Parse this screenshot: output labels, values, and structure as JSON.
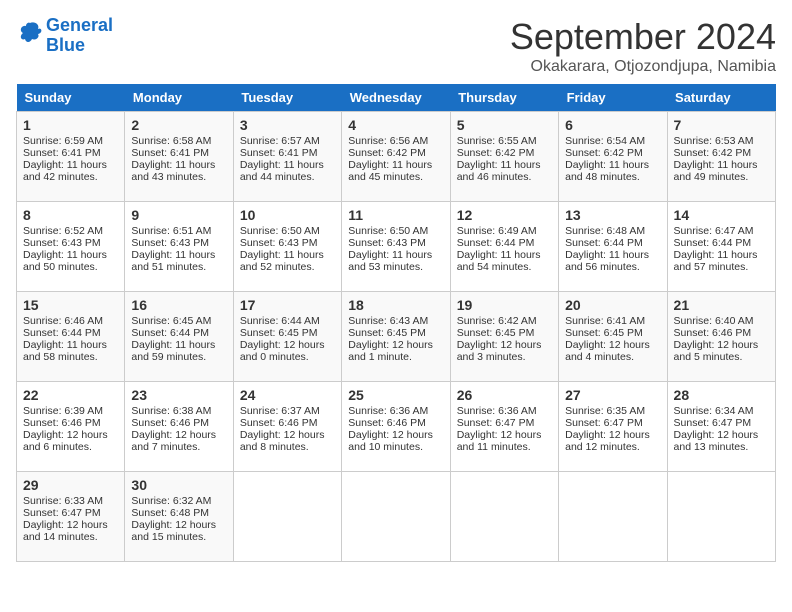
{
  "logo": {
    "line1": "General",
    "line2": "Blue"
  },
  "title": "September 2024",
  "location": "Okakarara, Otjozondjupa, Namibia",
  "days_header": [
    "Sunday",
    "Monday",
    "Tuesday",
    "Wednesday",
    "Thursday",
    "Friday",
    "Saturday"
  ],
  "weeks": [
    [
      {
        "num": "1",
        "lines": [
          "Sunrise: 6:59 AM",
          "Sunset: 6:41 PM",
          "Daylight: 11 hours",
          "and 42 minutes."
        ]
      },
      {
        "num": "2",
        "lines": [
          "Sunrise: 6:58 AM",
          "Sunset: 6:41 PM",
          "Daylight: 11 hours",
          "and 43 minutes."
        ]
      },
      {
        "num": "3",
        "lines": [
          "Sunrise: 6:57 AM",
          "Sunset: 6:41 PM",
          "Daylight: 11 hours",
          "and 44 minutes."
        ]
      },
      {
        "num": "4",
        "lines": [
          "Sunrise: 6:56 AM",
          "Sunset: 6:42 PM",
          "Daylight: 11 hours",
          "and 45 minutes."
        ]
      },
      {
        "num": "5",
        "lines": [
          "Sunrise: 6:55 AM",
          "Sunset: 6:42 PM",
          "Daylight: 11 hours",
          "and 46 minutes."
        ]
      },
      {
        "num": "6",
        "lines": [
          "Sunrise: 6:54 AM",
          "Sunset: 6:42 PM",
          "Daylight: 11 hours",
          "and 48 minutes."
        ]
      },
      {
        "num": "7",
        "lines": [
          "Sunrise: 6:53 AM",
          "Sunset: 6:42 PM",
          "Daylight: 11 hours",
          "and 49 minutes."
        ]
      }
    ],
    [
      {
        "num": "8",
        "lines": [
          "Sunrise: 6:52 AM",
          "Sunset: 6:43 PM",
          "Daylight: 11 hours",
          "and 50 minutes."
        ]
      },
      {
        "num": "9",
        "lines": [
          "Sunrise: 6:51 AM",
          "Sunset: 6:43 PM",
          "Daylight: 11 hours",
          "and 51 minutes."
        ]
      },
      {
        "num": "10",
        "lines": [
          "Sunrise: 6:50 AM",
          "Sunset: 6:43 PM",
          "Daylight: 11 hours",
          "and 52 minutes."
        ]
      },
      {
        "num": "11",
        "lines": [
          "Sunrise: 6:50 AM",
          "Sunset: 6:43 PM",
          "Daylight: 11 hours",
          "and 53 minutes."
        ]
      },
      {
        "num": "12",
        "lines": [
          "Sunrise: 6:49 AM",
          "Sunset: 6:44 PM",
          "Daylight: 11 hours",
          "and 54 minutes."
        ]
      },
      {
        "num": "13",
        "lines": [
          "Sunrise: 6:48 AM",
          "Sunset: 6:44 PM",
          "Daylight: 11 hours",
          "and 56 minutes."
        ]
      },
      {
        "num": "14",
        "lines": [
          "Sunrise: 6:47 AM",
          "Sunset: 6:44 PM",
          "Daylight: 11 hours",
          "and 57 minutes."
        ]
      }
    ],
    [
      {
        "num": "15",
        "lines": [
          "Sunrise: 6:46 AM",
          "Sunset: 6:44 PM",
          "Daylight: 11 hours",
          "and 58 minutes."
        ]
      },
      {
        "num": "16",
        "lines": [
          "Sunrise: 6:45 AM",
          "Sunset: 6:44 PM",
          "Daylight: 11 hours",
          "and 59 minutes."
        ]
      },
      {
        "num": "17",
        "lines": [
          "Sunrise: 6:44 AM",
          "Sunset: 6:45 PM",
          "Daylight: 12 hours",
          "and 0 minutes."
        ]
      },
      {
        "num": "18",
        "lines": [
          "Sunrise: 6:43 AM",
          "Sunset: 6:45 PM",
          "Daylight: 12 hours",
          "and 1 minute."
        ]
      },
      {
        "num": "19",
        "lines": [
          "Sunrise: 6:42 AM",
          "Sunset: 6:45 PM",
          "Daylight: 12 hours",
          "and 3 minutes."
        ]
      },
      {
        "num": "20",
        "lines": [
          "Sunrise: 6:41 AM",
          "Sunset: 6:45 PM",
          "Daylight: 12 hours",
          "and 4 minutes."
        ]
      },
      {
        "num": "21",
        "lines": [
          "Sunrise: 6:40 AM",
          "Sunset: 6:46 PM",
          "Daylight: 12 hours",
          "and 5 minutes."
        ]
      }
    ],
    [
      {
        "num": "22",
        "lines": [
          "Sunrise: 6:39 AM",
          "Sunset: 6:46 PM",
          "Daylight: 12 hours",
          "and 6 minutes."
        ]
      },
      {
        "num": "23",
        "lines": [
          "Sunrise: 6:38 AM",
          "Sunset: 6:46 PM",
          "Daylight: 12 hours",
          "and 7 minutes."
        ]
      },
      {
        "num": "24",
        "lines": [
          "Sunrise: 6:37 AM",
          "Sunset: 6:46 PM",
          "Daylight: 12 hours",
          "and 8 minutes."
        ]
      },
      {
        "num": "25",
        "lines": [
          "Sunrise: 6:36 AM",
          "Sunset: 6:46 PM",
          "Daylight: 12 hours",
          "and 10 minutes."
        ]
      },
      {
        "num": "26",
        "lines": [
          "Sunrise: 6:36 AM",
          "Sunset: 6:47 PM",
          "Daylight: 12 hours",
          "and 11 minutes."
        ]
      },
      {
        "num": "27",
        "lines": [
          "Sunrise: 6:35 AM",
          "Sunset: 6:47 PM",
          "Daylight: 12 hours",
          "and 12 minutes."
        ]
      },
      {
        "num": "28",
        "lines": [
          "Sunrise: 6:34 AM",
          "Sunset: 6:47 PM",
          "Daylight: 12 hours",
          "and 13 minutes."
        ]
      }
    ],
    [
      {
        "num": "29",
        "lines": [
          "Sunrise: 6:33 AM",
          "Sunset: 6:47 PM",
          "Daylight: 12 hours",
          "and 14 minutes."
        ]
      },
      {
        "num": "30",
        "lines": [
          "Sunrise: 6:32 AM",
          "Sunset: 6:48 PM",
          "Daylight: 12 hours",
          "and 15 minutes."
        ]
      },
      {
        "num": "",
        "lines": []
      },
      {
        "num": "",
        "lines": []
      },
      {
        "num": "",
        "lines": []
      },
      {
        "num": "",
        "lines": []
      },
      {
        "num": "",
        "lines": []
      }
    ]
  ]
}
